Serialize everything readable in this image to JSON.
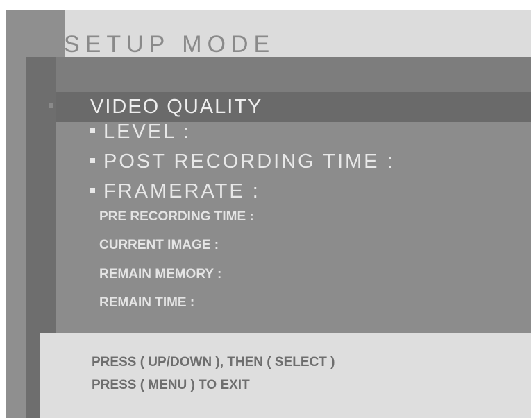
{
  "screen": {
    "title": "SETUP MODE"
  },
  "menu": {
    "selected": "VIDEO QUALITY",
    "large_items": [
      {
        "label": "LEVEL :"
      },
      {
        "label": "POST RECORDING TIME :"
      },
      {
        "label": "FRAMERATE :"
      }
    ],
    "small_items": [
      {
        "label": "PRE RECORDING TIME :"
      },
      {
        "label": "CURRENT IMAGE :"
      },
      {
        "label": "REMAIN MEMORY :"
      },
      {
        "label": "REMAIN TIME :"
      }
    ]
  },
  "footer": {
    "line1": "PRESS ( UP/DOWN ), THEN ( SELECT )",
    "line2": "PRESS ( MENU ) TO EXIT"
  },
  "colors": {
    "header_bg": "#dcdcdc",
    "panel_bg": "#8c8c8c",
    "highlight_bg": "#6a6a6a",
    "footer_bg": "#dedede"
  }
}
